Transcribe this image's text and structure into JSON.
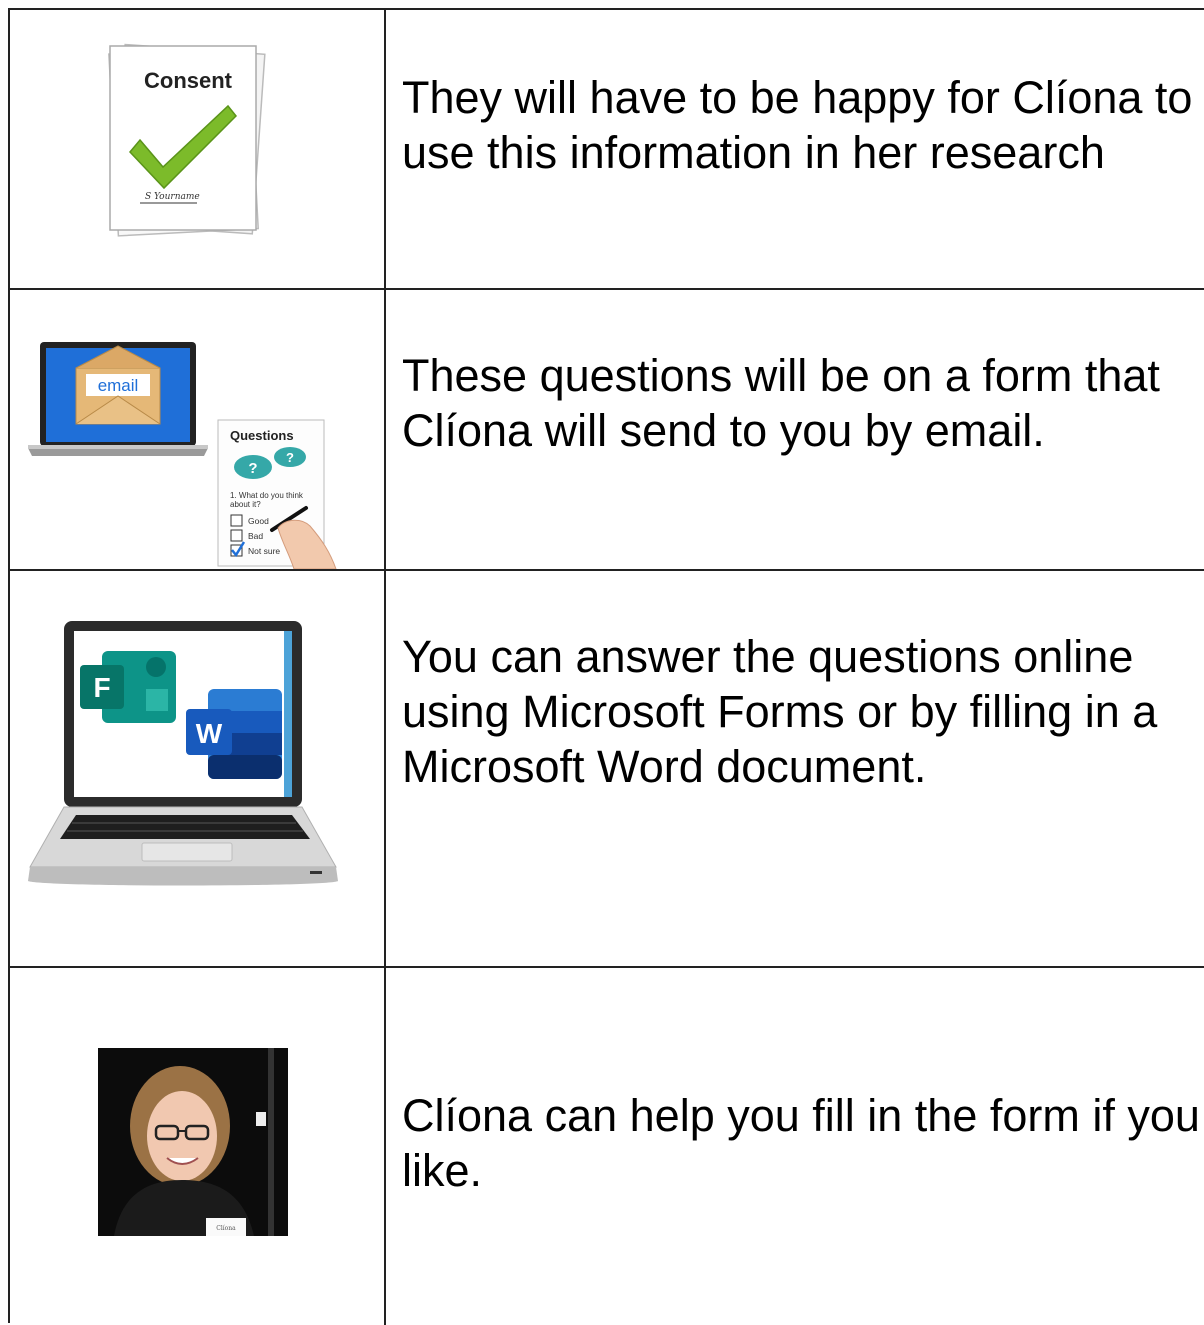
{
  "rows": [
    {
      "text": "They will have to be happy for Clíona to use this information in her research",
      "image": {
        "icon": "consent-form-icon",
        "title": "Consent",
        "signature": "S Yourname"
      }
    },
    {
      "text": "These questions will be on a form that Clíona will send to you by email.",
      "image": {
        "icon": "email-laptop-icon",
        "email_label": "email",
        "sheet_title": "Questions",
        "question_line1": "1. What do you think",
        "question_line2": "about it?",
        "options": [
          "Good",
          "Bad",
          "Not sure"
        ],
        "checked_option": "Not sure"
      }
    },
    {
      "text": "You can answer the questions online using Microsoft Forms or by filling in a Microsoft Word document.",
      "image": {
        "icon": "laptop-forms-word-icon",
        "forms_letter": "F",
        "word_letter": "W"
      }
    },
    {
      "text": "Clíona can help you fill in the form if you like.",
      "image": {
        "icon": "cliona-photo",
        "badge_text": "Clíona"
      }
    }
  ],
  "colors": {
    "check_green": "#7cbb2a",
    "teal": "#35a8a8",
    "email_blue": "#1f6fd8",
    "forms_teal": "#077568",
    "word_blue": "#185abd"
  }
}
